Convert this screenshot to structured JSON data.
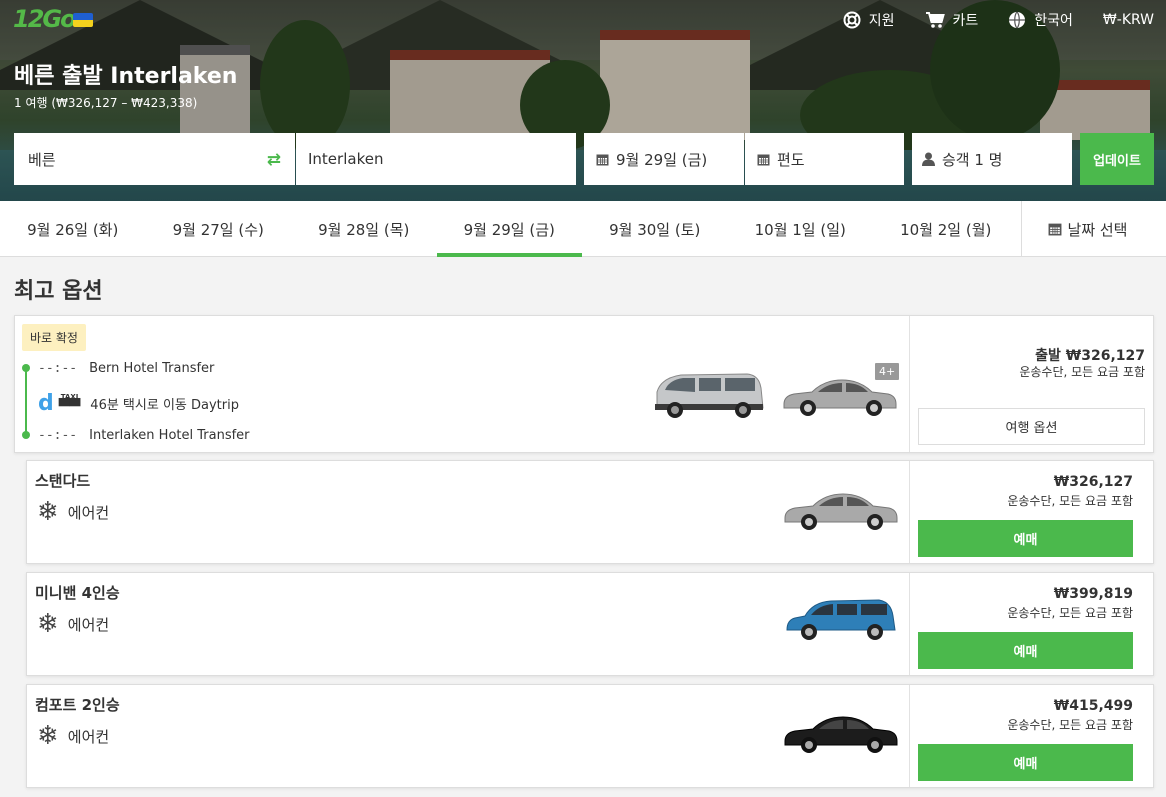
{
  "header": {
    "logo_text": "12Go",
    "nav": [
      {
        "icon": "lifebuoy-icon",
        "label": "지원"
      },
      {
        "icon": "cart-icon",
        "label": "카트"
      },
      {
        "icon": "globe-icon",
        "label": "한국어"
      },
      {
        "icon": "currency-icon",
        "label": "₩-KRW"
      }
    ],
    "route_title": "베른 출발 Interlaken",
    "route_subtitle": "1 여행 (₩326,127 – ₩423,338)"
  },
  "search": {
    "from": "베른",
    "to": "Interlaken",
    "date": "9월 29일 (금)",
    "trip_type": "편도",
    "passengers": "승객 1 명",
    "update_label": "업데이트"
  },
  "dates": {
    "tabs": [
      "9월 26일 (화)",
      "9월 27일 (수)",
      "9월 28일 (목)",
      "9월 29일 (금)",
      "9월 30일 (토)",
      "10월 1일 (일)",
      "10월 2일 (월)"
    ],
    "active_index": 3,
    "picker_label": "날짜 선택"
  },
  "section_title": "최고 옵션",
  "best_option": {
    "badge": "바로 확정",
    "depart_time": "--:--",
    "depart_place": "Bern Hotel Transfer",
    "operator_logo": "d",
    "duration_text": "46분 택시로 이동 Daytrip",
    "arrive_time": "--:--",
    "arrive_place": "Interlaken Hotel Transfer",
    "more_badge": "4+",
    "price_line": "출발 ₩326,127",
    "price_note": "운송수단, 모든 요금 포함",
    "options_label": "여행 옵션"
  },
  "classes": [
    {
      "name": "스탠다드",
      "amenity": "에어컨",
      "price": "₩326,127",
      "note": "운송수단, 모든 요금 포함",
      "book_label": "예매",
      "car_color": "#9a9a9a"
    },
    {
      "name": "미니밴 4인승",
      "amenity": "에어컨",
      "price": "₩399,819",
      "note": "운송수단, 모든 요금 포함",
      "book_label": "예매",
      "car_color": "#2e7fb8"
    },
    {
      "name": "컴포트 2인승",
      "amenity": "에어컨",
      "price": "₩415,499",
      "note": "운송수단, 모든 요금 포함",
      "book_label": "예매",
      "car_color": "#1a1a1a"
    }
  ],
  "colors": {
    "accent": "#4bb94c",
    "badge_bg": "#fdf0c0"
  }
}
